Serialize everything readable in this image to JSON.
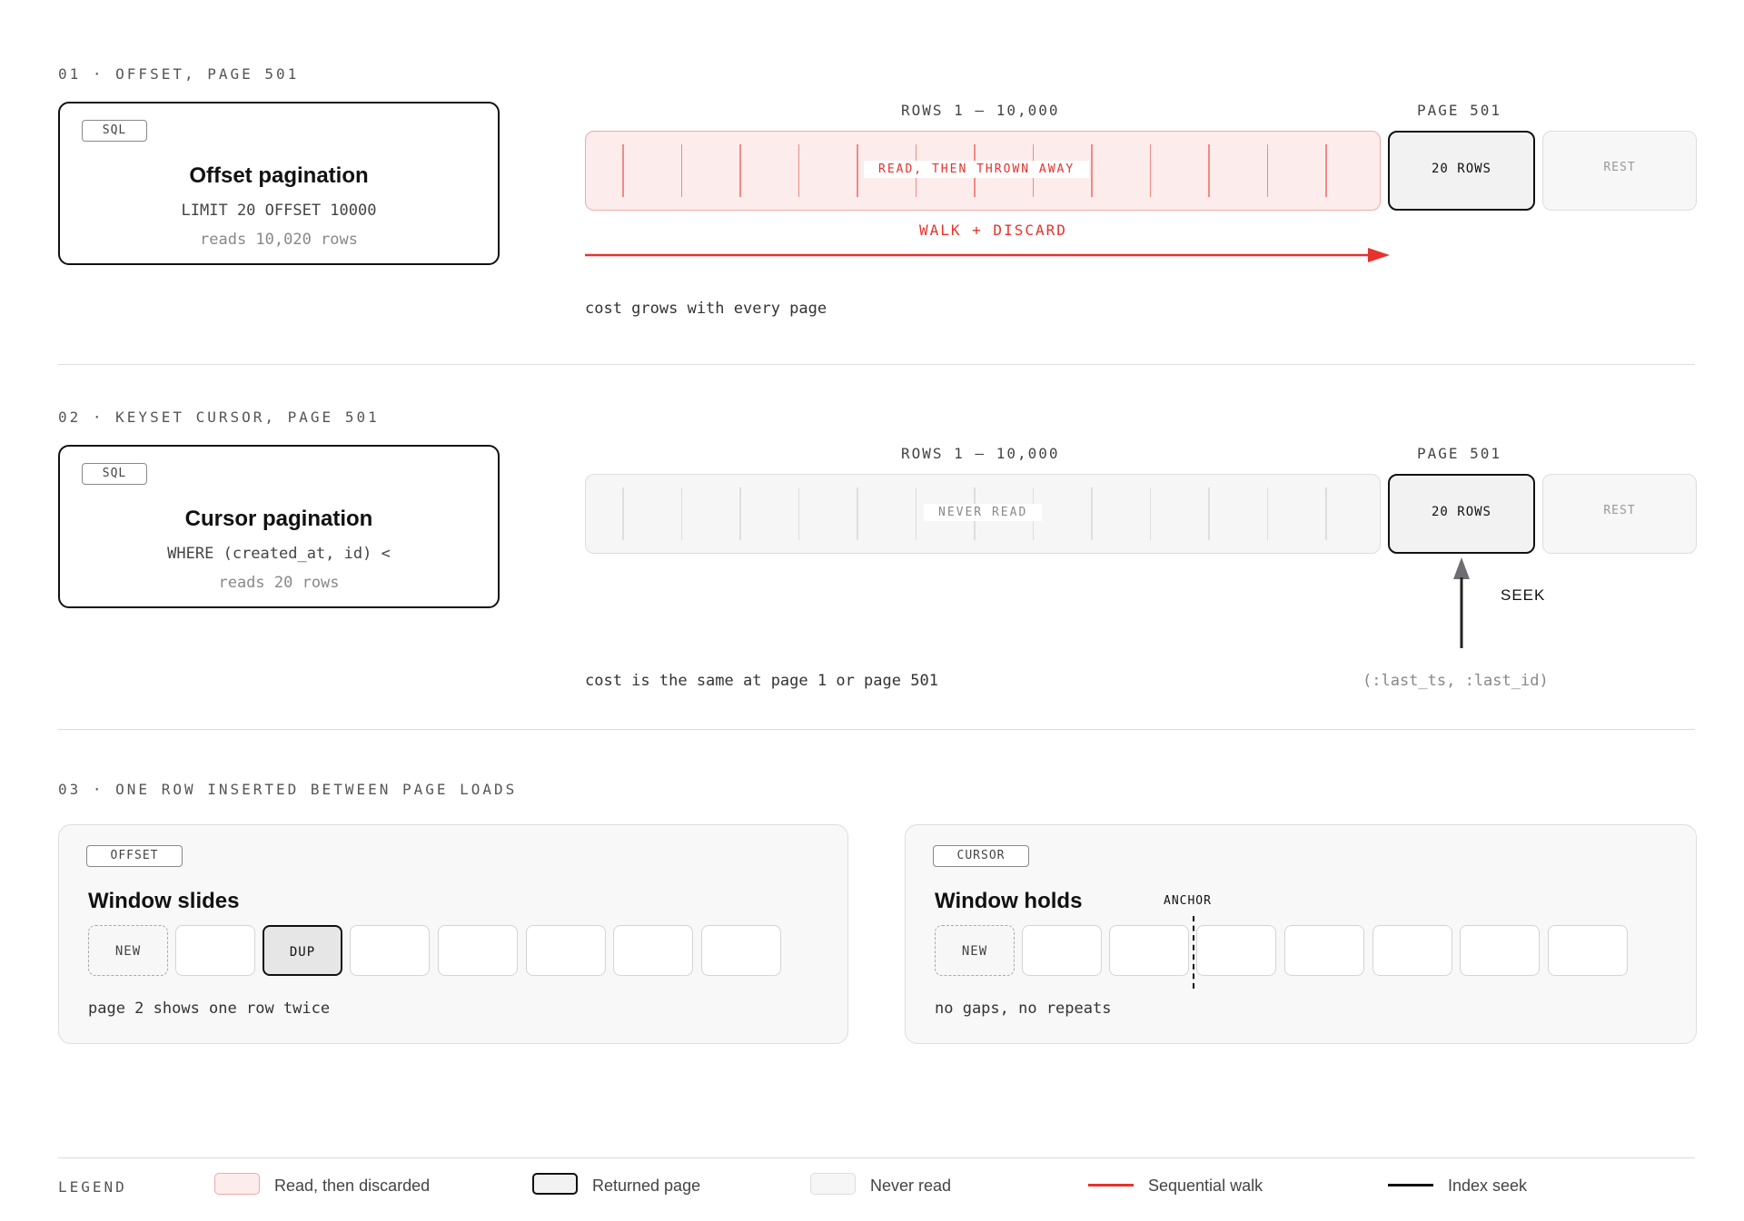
{
  "sections": {
    "offset": {
      "title": "01 · OFFSET, PAGE 501",
      "tag": "SQL",
      "card_title": "Offset pagination",
      "query": "LIMIT 20 OFFSET 10000",
      "reads": "reads 10,020 rows",
      "rows_label": "ROWS 1 – 10,000",
      "page_label": "PAGE 501",
      "bar_label": "READ, THEN THROWN AWAY",
      "page_cell": "20 ROWS",
      "rest_cell": "REST",
      "walk_label": "WALK + DISCARD",
      "caption": "cost grows with every page"
    },
    "cursor": {
      "title": "02 · KEYSET CURSOR, PAGE 501",
      "tag": "SQL",
      "card_title": "Cursor pagination",
      "query": "WHERE (created_at, id) <",
      "reads": "reads 20 rows",
      "rows_label": "ROWS 1 – 10,000",
      "page_label": "PAGE 501",
      "bar_label": "NEVER READ",
      "page_cell": "20 ROWS",
      "rest_cell": "REST",
      "seek_label": "SEEK",
      "caption": "cost is the same at page 1 or page 501",
      "params": "(:last_ts, :last_id)"
    },
    "insert": {
      "title": "03 · ONE ROW INSERTED BETWEEN PAGE LOADS",
      "offset_panel": {
        "tag": "OFFSET",
        "title": "Window slides",
        "new_cell": "NEW",
        "dup_cell": "DUP",
        "caption": "page 2 shows one row twice"
      },
      "cursor_panel": {
        "tag": "CURSOR",
        "title": "Window holds",
        "new_cell": "NEW",
        "anchor": "ANCHOR",
        "caption": "no gaps, no repeats"
      }
    }
  },
  "legend": {
    "title": "LEGEND",
    "items": [
      {
        "label": "Read, then discarded"
      },
      {
        "label": "Returned page"
      },
      {
        "label": "Never read"
      },
      {
        "label": "Sequential walk"
      },
      {
        "label": "Index seek"
      }
    ]
  },
  "colors": {
    "red": "#e8322b",
    "red_fill": "#fdecec",
    "dark": "#111111",
    "grey_fill": "#f5f5f5"
  }
}
